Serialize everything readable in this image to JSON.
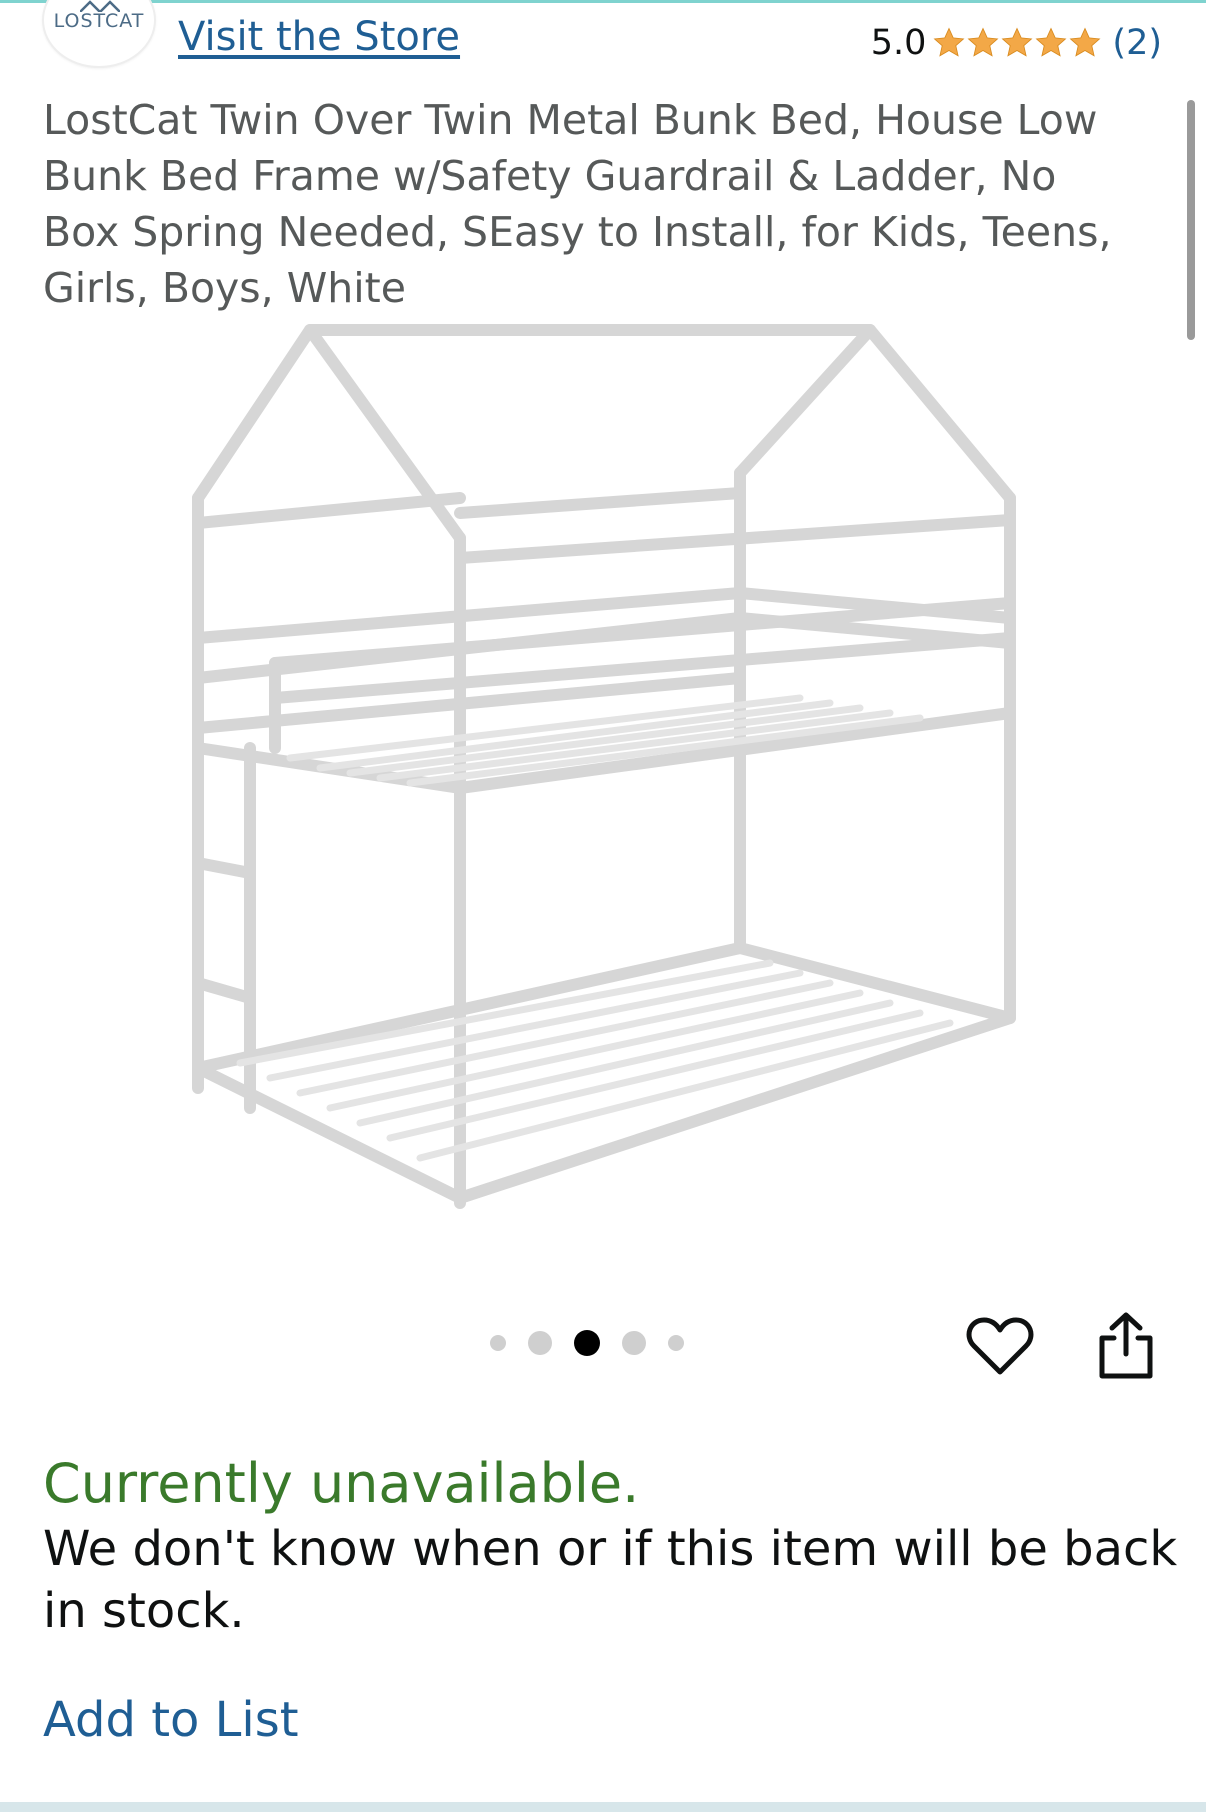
{
  "header": {
    "brand_logo_text": "LOSTCAT",
    "store_link": "Visit the Store",
    "rating_value": "5.0",
    "stars_filled": 5,
    "review_count": "(2)"
  },
  "product": {
    "title": "LostCat Twin Over Twin Metal Bunk Bed, House Low Bunk Bed Frame w/Safety Guardrail & Ladder, No Box Spring Needed, SEasy to Install, for Kids, Teens, Girls, Boys, White"
  },
  "carousel": {
    "image_count": 5,
    "active_index": 2
  },
  "actions": {
    "wishlist_icon": "heart-icon",
    "share_icon": "share-icon"
  },
  "availability": {
    "status": "Currently unavailable.",
    "message": "We don't know when or if this item will be back in stock."
  },
  "add_to_list": "Add to List",
  "colors": {
    "link": "#1f5e94",
    "star": "#f3a847",
    "unavailable": "#3a7a2b"
  }
}
